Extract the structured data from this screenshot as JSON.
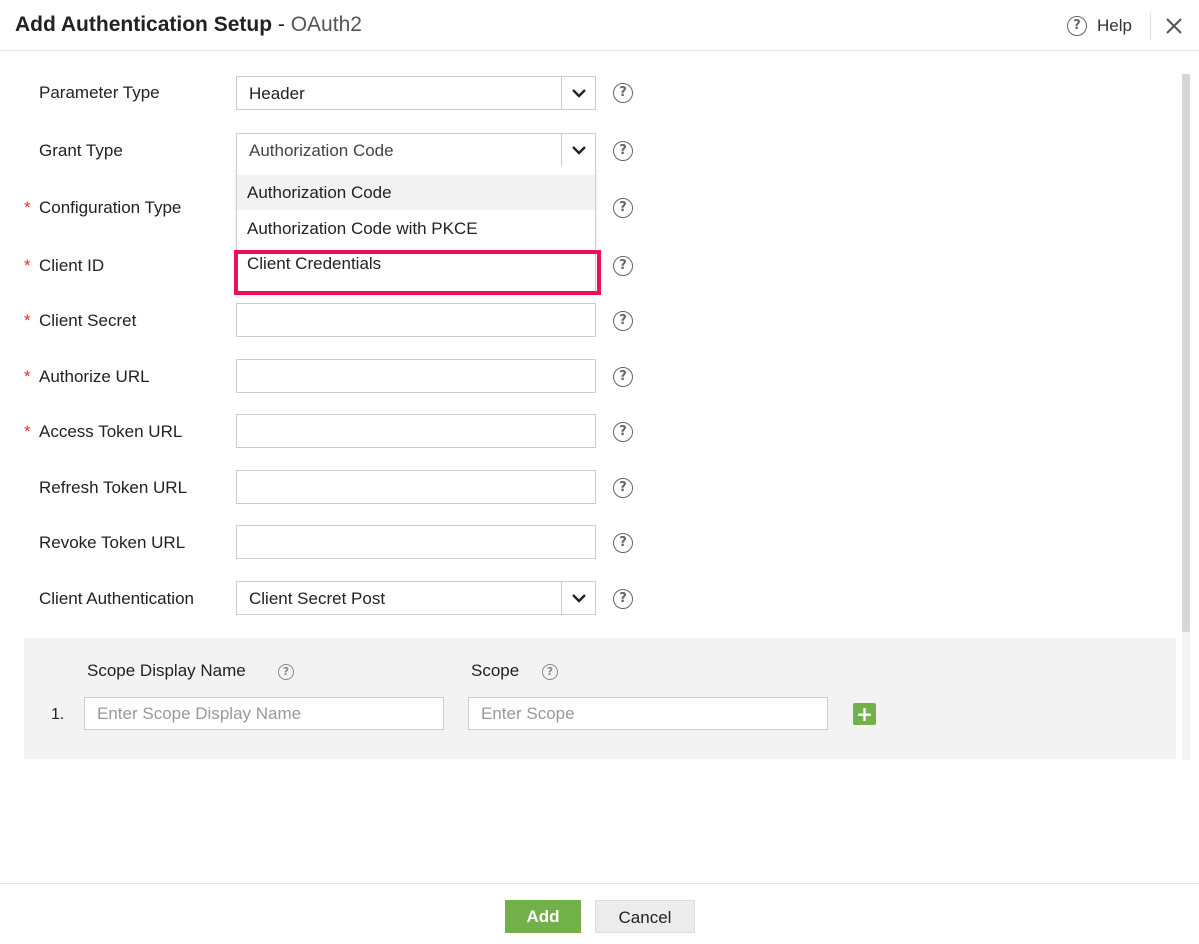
{
  "header": {
    "title_main": "Add Authentication Setup",
    "title_sep": " - ",
    "title_sub": "OAuth2",
    "help_label": "Help",
    "help_glyph": "?",
    "close_glyph": "close-icon"
  },
  "form": {
    "parameter_type": {
      "label": "Parameter Type",
      "value": "Header"
    },
    "grant_type": {
      "label": "Grant Type",
      "value": "Authorization Code",
      "options": [
        "Authorization Code",
        "Authorization Code with PKCE",
        "Client Credentials"
      ],
      "highlighted_option": "Client Credentials"
    },
    "configuration_type": {
      "label": "Configuration Type",
      "required": "*"
    },
    "client_id": {
      "label": "Client ID",
      "required": "*",
      "value": ""
    },
    "client_secret": {
      "label": "Client Secret",
      "required": "*",
      "value": ""
    },
    "authorize_url": {
      "label": "Authorize URL",
      "required": "*",
      "value": ""
    },
    "access_token_url": {
      "label": "Access Token URL",
      "required": "*",
      "value": ""
    },
    "refresh_token_url": {
      "label": "Refresh Token URL",
      "value": ""
    },
    "revoke_token_url": {
      "label": "Revoke Token URL",
      "value": ""
    },
    "client_authentication": {
      "label": "Client Authentication",
      "value": "Client Secret Post"
    }
  },
  "scope": {
    "display_name_header": "Scope Display Name",
    "scope_header": "Scope",
    "rows": [
      {
        "number": "1.",
        "display_placeholder": "Enter Scope Display Name",
        "scope_placeholder": "Enter Scope"
      }
    ],
    "add_glyph": "+"
  },
  "footer": {
    "add_label": "Add",
    "cancel_label": "Cancel"
  },
  "colors": {
    "accent_green": "#72b04a",
    "highlight_pink": "#ee0f5a",
    "required_red": "#d33333"
  }
}
